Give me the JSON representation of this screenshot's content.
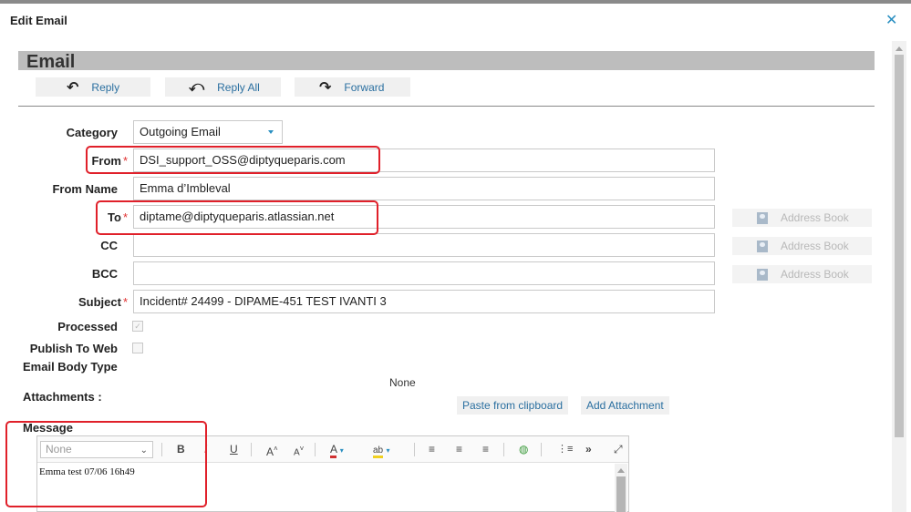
{
  "dialog": {
    "title": "Edit Email",
    "close_icon": "close-icon"
  },
  "section": {
    "title": "Email"
  },
  "toolbar": {
    "reply": "Reply",
    "reply_all": "Reply All",
    "forward": "Forward"
  },
  "form": {
    "category": {
      "label": "Category",
      "value": "Outgoing Email"
    },
    "from": {
      "label": "From",
      "value": "DSI_support_OSS@diptyqueparis.com",
      "required": "*"
    },
    "from_name": {
      "label": "From Name",
      "value": "Emma d’Imbleval"
    },
    "to": {
      "label": "To",
      "value": "diptame@diptyqueparis.atlassian.net",
      "required": "*"
    },
    "cc": {
      "label": "CC",
      "value": ""
    },
    "bcc": {
      "label": "BCC",
      "value": ""
    },
    "subject": {
      "label": "Subject",
      "value": "Incident# 24499 - DIPAME-451 TEST IVANTI 3",
      "required": "*"
    },
    "processed": {
      "label": "Processed",
      "checked": true
    },
    "publish_to_web": {
      "label": "Publish To Web",
      "checked": false
    },
    "email_body_type": {
      "label": "Email Body Type"
    },
    "address_book": "Address Book"
  },
  "attachments": {
    "label": "Attachments :",
    "value": "None",
    "paste_button": "Paste from clipboard",
    "add_button": "Add Attachment"
  },
  "message": {
    "label": "Message",
    "format_select": "None",
    "body": "Emma test 07/06 16h49"
  },
  "colors": {
    "accent": "#2a8fc1",
    "highlight": "#e0202a",
    "section_bar": "#bdbdbd"
  }
}
